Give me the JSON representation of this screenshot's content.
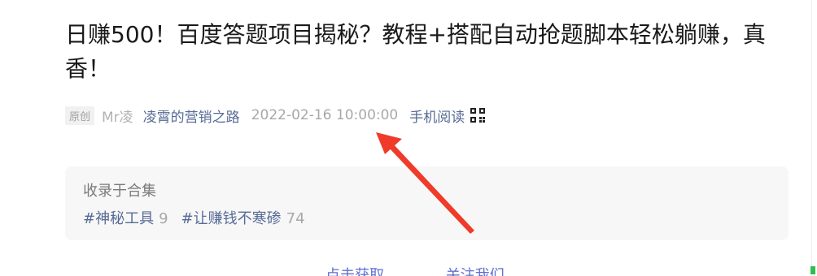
{
  "article": {
    "title": "日赚500！百度答题项目揭秘？教程+搭配自动抢题脚本轻松躺赚，真香！"
  },
  "meta": {
    "badge": "原创",
    "author": "Mr凌",
    "account": "凌霄的营销之路",
    "datetime": "2022-02-16 10:00:00",
    "mobile_read": "手机阅读",
    "qr_icon": "qr-code-icon"
  },
  "collection": {
    "label": "收录于合集",
    "tags": [
      {
        "name": "#神秘工具",
        "count": "9"
      },
      {
        "name": "#让赚钱不寒碜",
        "count": "74"
      }
    ]
  },
  "footer": {
    "link1": "点击获取",
    "link2": "关注我们"
  },
  "annotation": {
    "arrow_color": "#f03a2a"
  }
}
